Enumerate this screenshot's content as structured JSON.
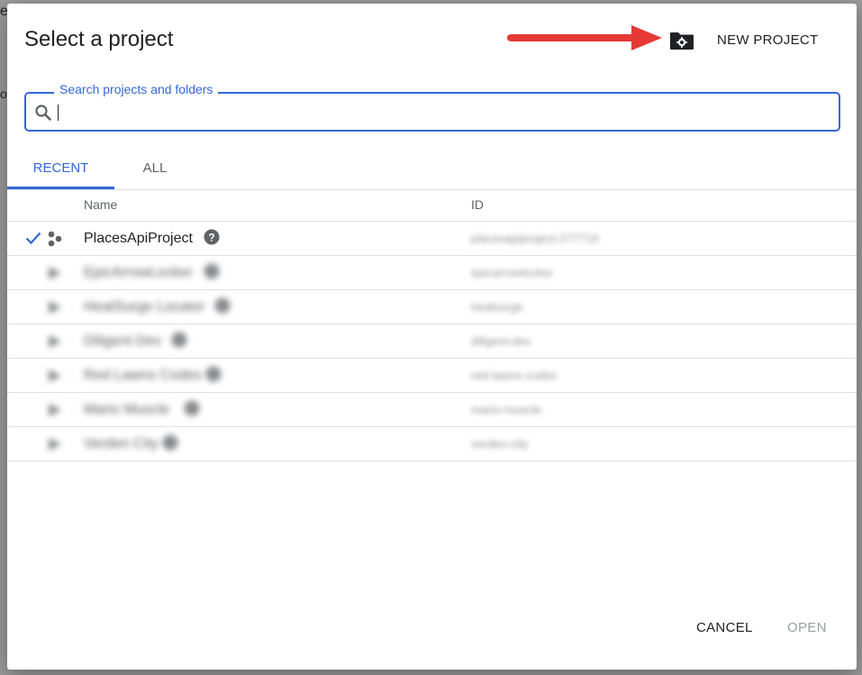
{
  "background": {
    "peek_text_1": "e",
    "peek_text_2": "o"
  },
  "dialog": {
    "title": "Select a project",
    "new_project_label": "NEW PROJECT",
    "search": {
      "label": "Search projects and folders",
      "value": "",
      "placeholder": ""
    },
    "tabs": [
      {
        "label": "RECENT",
        "active": true
      },
      {
        "label": "ALL",
        "active": false
      }
    ],
    "table": {
      "headers": {
        "name": "Name",
        "id": "ID"
      },
      "rows": [
        {
          "name": "PlacesApiProject",
          "id": "placesapiproject-277710",
          "selected": true,
          "blurred": false
        },
        {
          "name": "EpicArrowLocker",
          "id": "epicarrowlocker",
          "selected": false,
          "blurred": true
        },
        {
          "name": "HeatSurge Locator",
          "id": "heatsurge",
          "selected": false,
          "blurred": true
        },
        {
          "name": "Diligent Dev",
          "id": "diligent-dev",
          "selected": false,
          "blurred": true
        },
        {
          "name": "Red Lawns Codes",
          "id": "red-lawns-codes",
          "selected": false,
          "blurred": true
        },
        {
          "name": "Mario Muscle",
          "id": "mario-muscle",
          "selected": false,
          "blurred": true
        },
        {
          "name": "Verden City",
          "id": "verden-city",
          "selected": false,
          "blurred": true
        }
      ]
    },
    "footer": {
      "cancel_label": "CANCEL",
      "open_label": "OPEN"
    }
  },
  "colors": {
    "accent": "#3367d6",
    "arrow": "#e53935",
    "disabled": "#9aa0a6"
  }
}
